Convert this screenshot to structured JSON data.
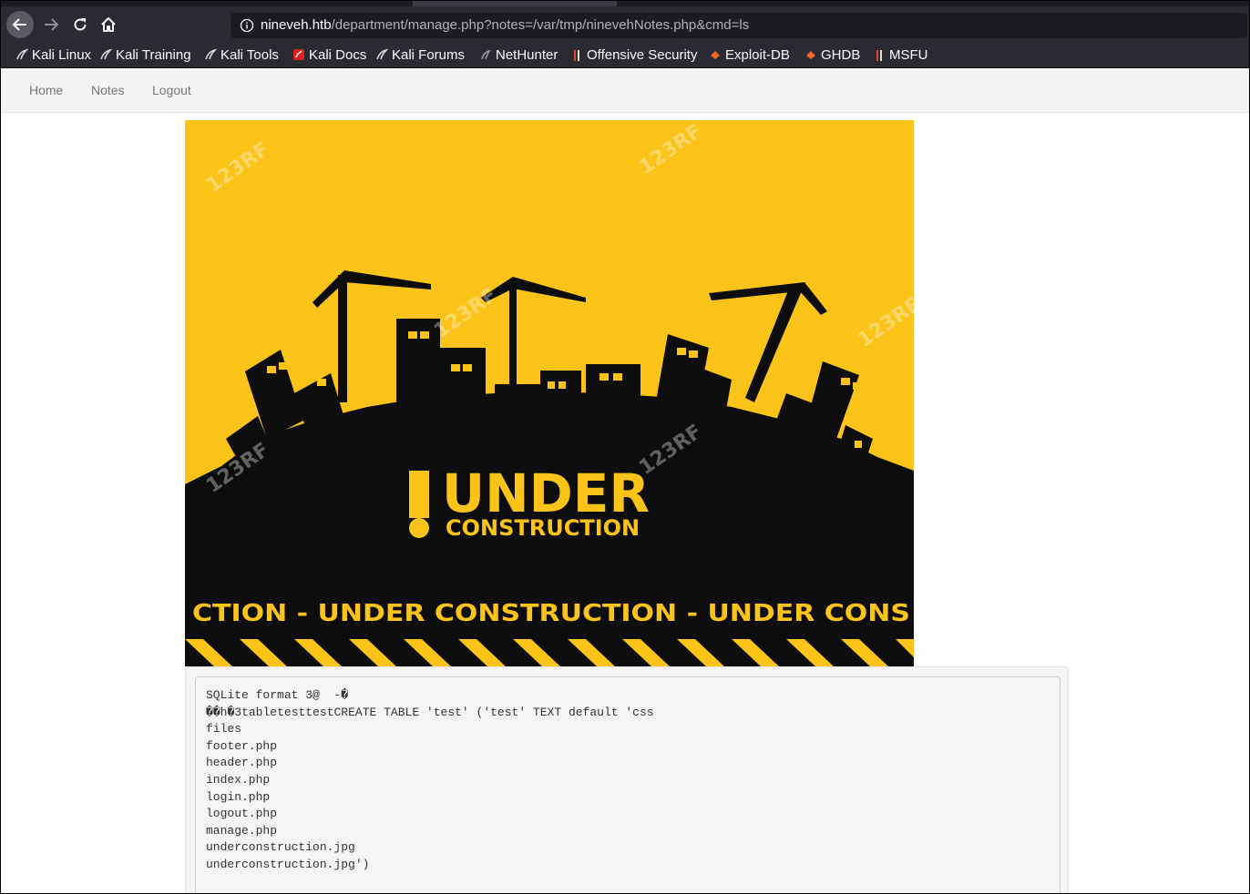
{
  "browser": {
    "url_host": "nineveh.htb",
    "url_path": "/department/manage.php?notes=/var/tmp/ninevehNotes.php&cmd=ls",
    "bookmarks": [
      {
        "label": "Kali Linux",
        "icon": "kali-icon"
      },
      {
        "label": "Kali Training",
        "icon": "kali-icon"
      },
      {
        "label": "Kali Tools",
        "icon": "kali-icon"
      },
      {
        "label": "Kali Docs",
        "icon": "docs-icon"
      },
      {
        "label": "Kali Forums",
        "icon": "kali-icon"
      },
      {
        "label": "NetHunter",
        "icon": "nethunter-icon"
      },
      {
        "label": "Offensive Security",
        "icon": "offsec-icon"
      },
      {
        "label": "Exploit-DB",
        "icon": "exploitdb-icon"
      },
      {
        "label": "GHDB",
        "icon": "exploitdb-icon"
      },
      {
        "label": "MSFU",
        "icon": "offsec-icon"
      }
    ]
  },
  "site_nav": {
    "home": "Home",
    "notes": "Notes",
    "logout": "Logout"
  },
  "banner": {
    "headline": "UNDER",
    "subline": "CONSTRUCTION",
    "ticker": "CTION - UNDER  CONSTRUCTION - UNDER  CONS",
    "watermark": "123RF"
  },
  "output": {
    "lines": [
      "SQLite format 3@  -�",
      "��h�3tabletesttestCREATE TABLE 'test' ('test' TEXT default 'css",
      "files",
      "footer.php",
      "header.php",
      "index.php",
      "login.php",
      "logout.php",
      "manage.php",
      "underconstruction.jpg",
      "underconstruction.jpg')"
    ]
  },
  "colors": {
    "banner_yellow": "#fcc318",
    "banner_black": "#0d0d0d"
  }
}
